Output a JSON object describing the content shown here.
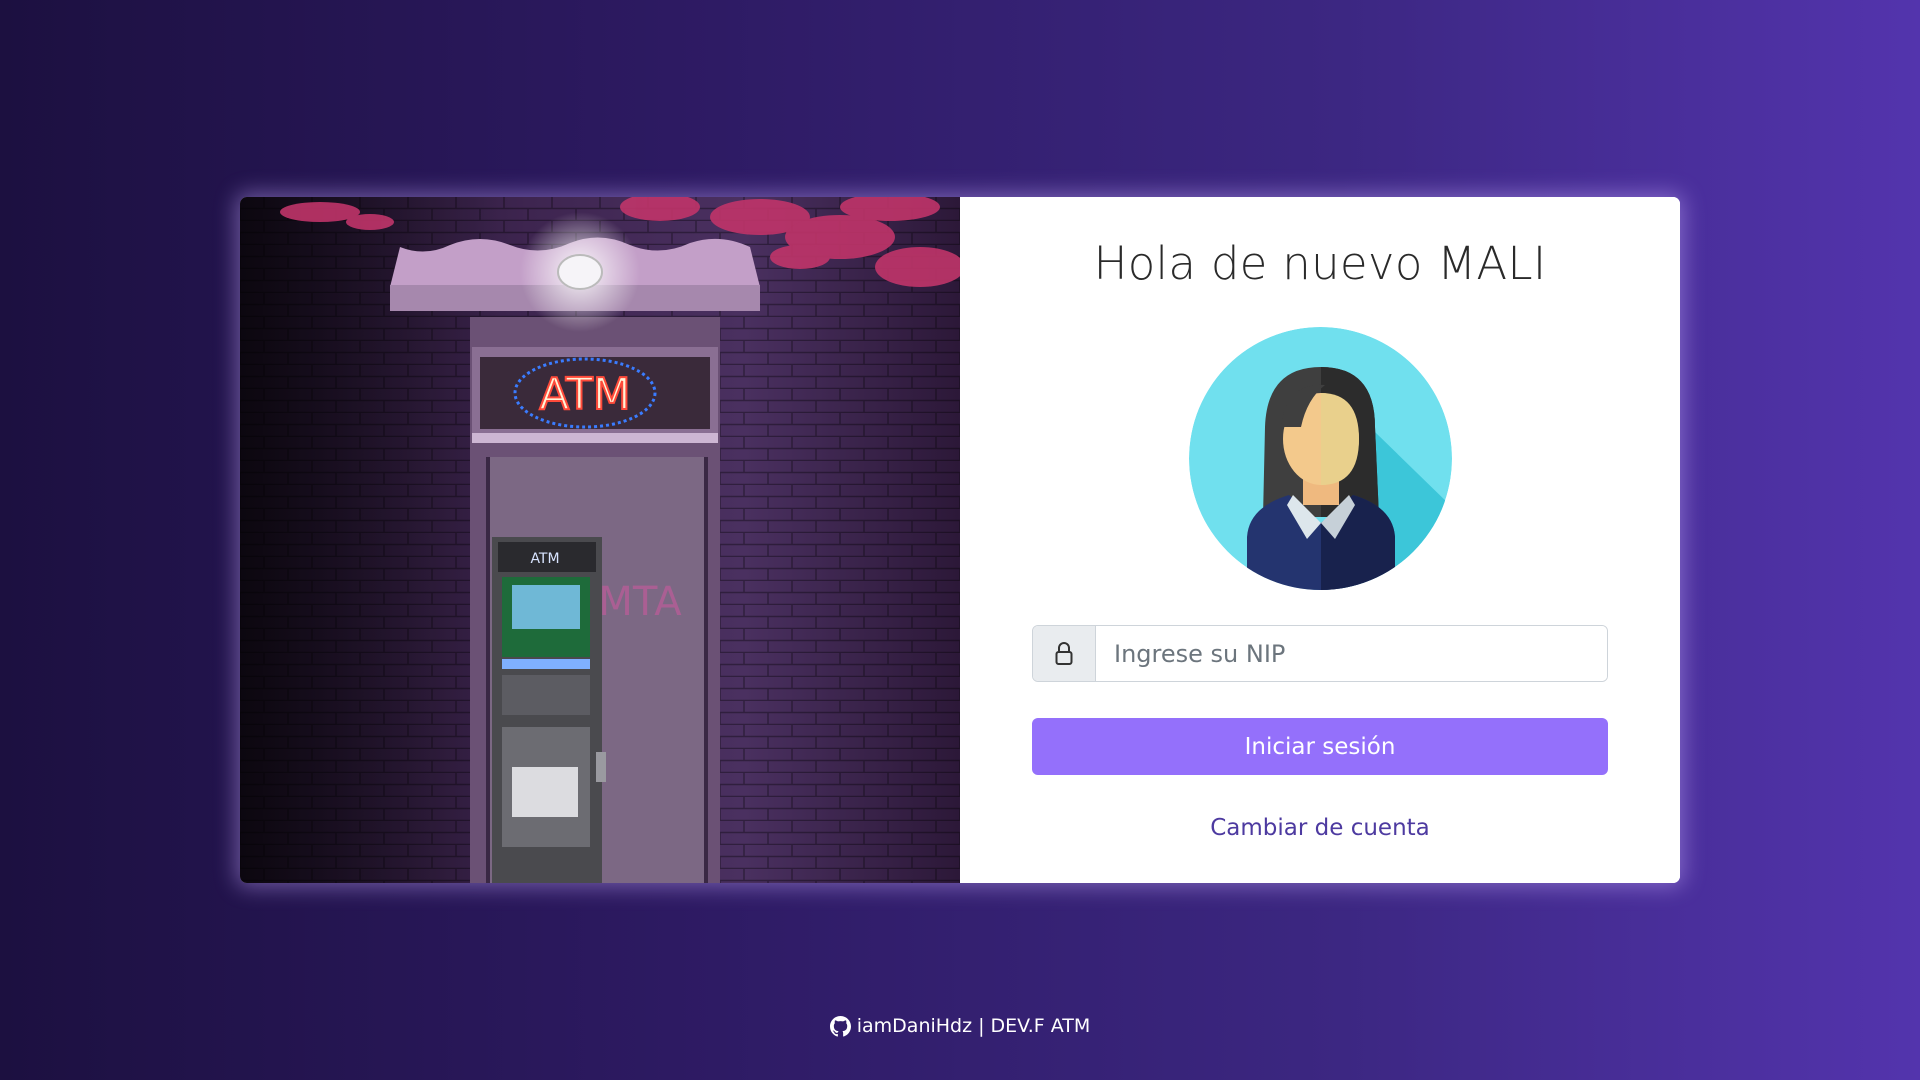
{
  "login": {
    "greeting": "Hola de nuevo MALI",
    "pin_placeholder": "Ingrese su NIP",
    "submit_label": "Iniciar sesión",
    "switch_account_label": "Cambiar de cuenta"
  },
  "hero": {
    "sign_text": "ATM",
    "machine_text": "ATM"
  },
  "footer": {
    "author": "iamDaniHdz",
    "separator": "|",
    "project": "DEV.F ATM"
  },
  "icons": {
    "lock": "lock-icon",
    "github": "github-icon"
  },
  "colors": {
    "primary_button": "#9470fb",
    "link": "#4d3aa0",
    "avatar_bg": "#70e0ee"
  }
}
